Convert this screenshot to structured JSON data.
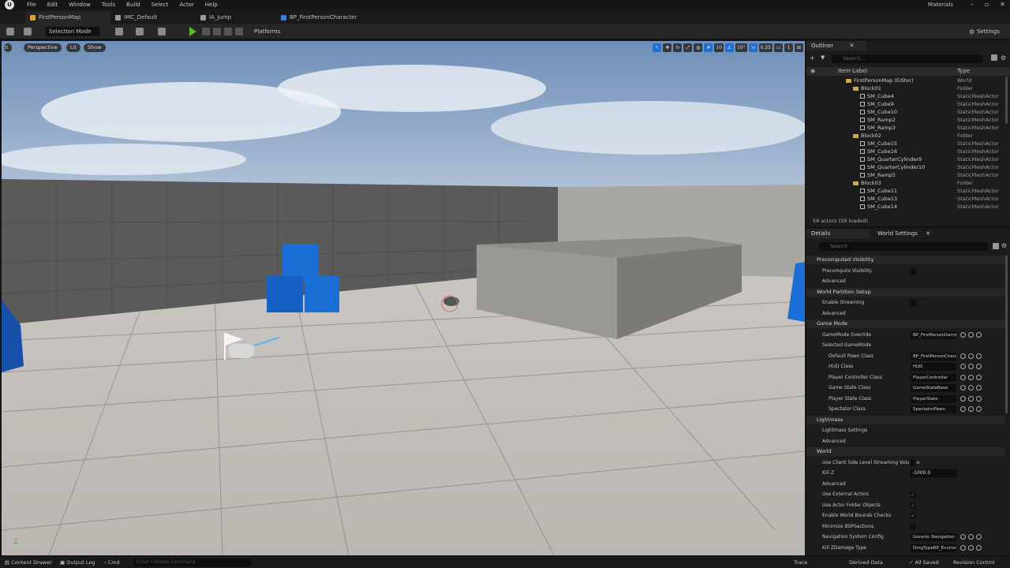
{
  "menubar": {
    "logo": "U",
    "items": [
      "File",
      "Edit",
      "Window",
      "Tools",
      "Build",
      "Select",
      "Actor",
      "Help"
    ],
    "project": "Materials"
  },
  "tabs": [
    {
      "label": "FirstPersonMap",
      "color": "#e0a030"
    },
    {
      "label": "IMC_Default",
      "color": "#c9c9c9"
    },
    {
      "label": "IA_Jump",
      "color": "#c9c9c9"
    },
    {
      "label": "BP_FirstPersonCharacter",
      "color": "#3a7be0"
    }
  ],
  "tooltip": "FirstPersonMap",
  "toolbar": {
    "select_mode": "Selection Mode",
    "platforms": "Platforms",
    "settings": "Settings"
  },
  "viewport": {
    "perspective": "Perspective",
    "lit": "Lit",
    "show": "Show",
    "grid_snap": "10",
    "rot_snap": "10°",
    "scale_snap": "0.25",
    "cam_speed": "1"
  },
  "outliner": {
    "tab": "Outliner",
    "search_placeholder": "Search...",
    "col_label": "Item Label",
    "col_type": "Type",
    "rows": [
      {
        "name": "FirstPersonMap (Editor)",
        "type": "World",
        "indent": 0,
        "kind": "world"
      },
      {
        "name": "Block01",
        "type": "Folder",
        "indent": 1,
        "kind": "folder"
      },
      {
        "name": "SM_Cube4",
        "type": "StaticMeshActor",
        "indent": 2,
        "kind": "mesh"
      },
      {
        "name": "SM_Cube9",
        "type": "StaticMeshActor",
        "indent": 2,
        "kind": "mesh"
      },
      {
        "name": "SM_Cube10",
        "type": "StaticMeshActor",
        "indent": 2,
        "kind": "mesh"
      },
      {
        "name": "SM_Ramp2",
        "type": "StaticMeshActor",
        "indent": 2,
        "kind": "mesh"
      },
      {
        "name": "SM_Ramp3",
        "type": "StaticMeshActor",
        "indent": 2,
        "kind": "mesh"
      },
      {
        "name": "Block02",
        "type": "Folder",
        "indent": 1,
        "kind": "folder"
      },
      {
        "name": "SM_Cube15",
        "type": "StaticMeshActor",
        "indent": 2,
        "kind": "mesh"
      },
      {
        "name": "SM_Cube16",
        "type": "StaticMeshActor",
        "indent": 2,
        "kind": "mesh"
      },
      {
        "name": "SM_QuarterCylinder9",
        "type": "StaticMeshActor",
        "indent": 2,
        "kind": "mesh"
      },
      {
        "name": "SM_QuarterCylinder10",
        "type": "StaticMeshActor",
        "indent": 2,
        "kind": "mesh"
      },
      {
        "name": "SM_Ramp5",
        "type": "StaticMeshActor",
        "indent": 2,
        "kind": "mesh"
      },
      {
        "name": "Block03",
        "type": "Folder",
        "indent": 1,
        "kind": "folder"
      },
      {
        "name": "SM_Cube11",
        "type": "StaticMeshActor",
        "indent": 2,
        "kind": "mesh"
      },
      {
        "name": "SM_Cube13",
        "type": "StaticMeshActor",
        "indent": 2,
        "kind": "mesh"
      },
      {
        "name": "SM_Cube14",
        "type": "StaticMeshActor",
        "indent": 2,
        "kind": "mesh"
      }
    ],
    "count": "59 actors (59 loaded)"
  },
  "details": {
    "tab_details": "Details",
    "tab_world": "World Settings",
    "search_placeholder": "Search",
    "rows": [
      {
        "kind": "section",
        "label": "Precomputed Visibility"
      },
      {
        "kind": "check",
        "label": "Precompute Visibility",
        "checked": false,
        "indent": 1
      },
      {
        "kind": "sub",
        "label": "Advanced",
        "indent": 1
      },
      {
        "kind": "section",
        "label": "World Partition Setup"
      },
      {
        "kind": "check",
        "label": "Enable Streaming",
        "checked": false,
        "indent": 1
      },
      {
        "kind": "sub",
        "label": "Advanced",
        "indent": 1
      },
      {
        "kind": "section",
        "label": "Game Mode"
      },
      {
        "kind": "dropdown",
        "label": "GameMode Override",
        "value": "BP_FirstPersonGameMode",
        "indent": 1
      },
      {
        "kind": "sub",
        "label": "Selected GameMode",
        "indent": 1
      },
      {
        "kind": "dropdown",
        "label": "Default Pawn Class",
        "value": "BP_FirstPersonCharacter",
        "indent": 2
      },
      {
        "kind": "dropdown",
        "label": "HUD Class",
        "value": "HUD",
        "indent": 2
      },
      {
        "kind": "dropdown",
        "label": "Player Controller Class",
        "value": "PlayerController",
        "indent": 2
      },
      {
        "kind": "dropdown",
        "label": "Game State Class",
        "value": "GameStateBase",
        "indent": 2
      },
      {
        "kind": "dropdown",
        "label": "Player State Class",
        "value": "PlayerState",
        "indent": 2
      },
      {
        "kind": "dropdown",
        "label": "Spectator Class",
        "value": "SpectatorPawn",
        "indent": 2
      },
      {
        "kind": "section",
        "label": "Lightmass"
      },
      {
        "kind": "sub",
        "label": "Lightmass Settings",
        "indent": 1
      },
      {
        "kind": "sub",
        "label": "Advanced",
        "indent": 1
      },
      {
        "kind": "section",
        "label": "World"
      },
      {
        "kind": "check",
        "label": "Use Client Side Level Streaming Volumes",
        "checked": false,
        "indent": 1
      },
      {
        "kind": "number",
        "label": "Kill Z",
        "value": "-1000.0",
        "indent": 1
      },
      {
        "kind": "sub",
        "label": "Advanced",
        "indent": 1
      },
      {
        "kind": "check",
        "label": "Use External Actors",
        "checked": true,
        "indent": 1
      },
      {
        "kind": "check",
        "label": "Use Actor Folder Objects",
        "checked": true,
        "indent": 1
      },
      {
        "kind": "check",
        "label": "Enable World Bounds Checks",
        "checked": true,
        "indent": 1
      },
      {
        "kind": "check",
        "label": "Minimize BSPSections",
        "checked": false,
        "indent": 1
      },
      {
        "kind": "dropdown",
        "label": "Navigation System Config",
        "value": "Generic Navigation System Config",
        "indent": 1
      },
      {
        "kind": "dropdown",
        "label": "Kill ZDamage Type",
        "value": "DmgTypeBP_Environmental",
        "indent": 1
      }
    ]
  },
  "statusbar": {
    "content_drawer": "Content Drawer",
    "output_log": "Output Log",
    "cmd": "Cmd",
    "cmd_placeholder": "Enter Console Command",
    "trace": "Trace",
    "derived_data": "Derived Data",
    "all_saved": "All Saved",
    "revision_control": "Revision Control"
  }
}
